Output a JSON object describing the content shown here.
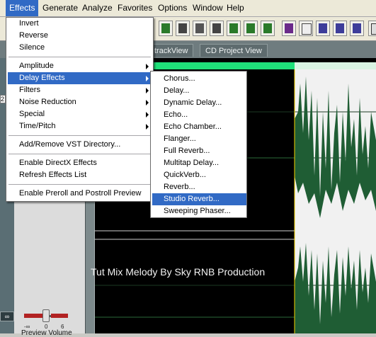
{
  "menubar": {
    "items": [
      "Effects",
      "Generate",
      "Analyze",
      "Favorites",
      "Options",
      "Window",
      "Help"
    ]
  },
  "tabs": [
    "trackView",
    "CD Project View"
  ],
  "effects_menu": {
    "items": [
      {
        "label": "Invert",
        "submenu": false
      },
      {
        "label": "Reverse",
        "submenu": false
      },
      {
        "label": "Silence",
        "submenu": false
      },
      {
        "label": "Amplitude",
        "submenu": true
      },
      {
        "label": "Delay Effects",
        "submenu": true
      },
      {
        "label": "Filters",
        "submenu": true
      },
      {
        "label": "Noise Reduction",
        "submenu": true
      },
      {
        "label": "Special",
        "submenu": true
      },
      {
        "label": "Time/Pitch",
        "submenu": true
      },
      {
        "label": "Add/Remove VST Directory...",
        "submenu": false
      },
      {
        "label": "Enable DirectX Effects",
        "submenu": false
      },
      {
        "label": "Refresh Effects List",
        "submenu": false
      },
      {
        "label": "Enable Preroll and Postroll Preview",
        "submenu": false
      }
    ]
  },
  "delay_submenu": {
    "items": [
      "Chorus...",
      "Delay...",
      "Dynamic Delay...",
      "Echo...",
      "Echo Chamber...",
      "Flanger...",
      "Full Reverb...",
      "Multitap Delay...",
      "QuickVerb...",
      "Reverb...",
      "Studio Reverb...",
      "Sweeping Phaser..."
    ]
  },
  "left_panel": {
    "side_value": "2",
    "loop_label": "∞",
    "scale_labels": [
      "-∞",
      "0",
      "6"
    ],
    "preview_volume_label": "Preview Volume"
  },
  "overlay_text": "Tut Mix Melody By Sky RNB Production",
  "colors": {
    "accent": "#316ac5",
    "waveform": "#1f6b3a",
    "timeline": "#1fe07a"
  }
}
